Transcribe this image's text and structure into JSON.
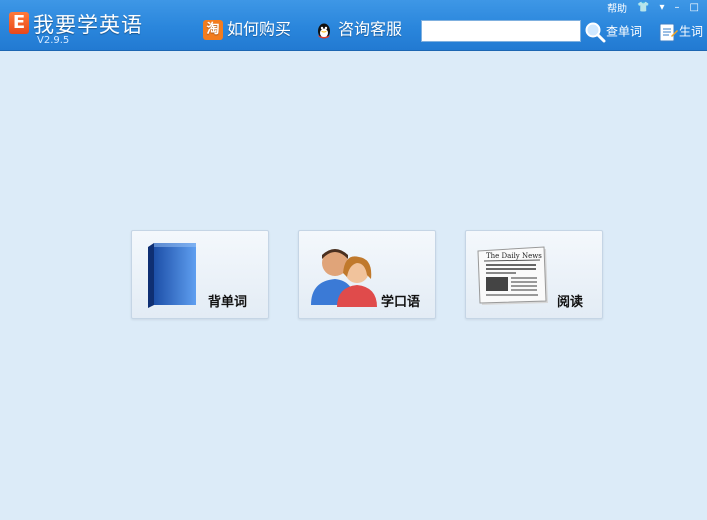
{
  "app": {
    "title": "我要学英语",
    "version": "V2.9.5",
    "logo_letter": "E"
  },
  "window_controls": {
    "help": "帮助",
    "skin": "👕",
    "menu": "▾",
    "minimize": "–",
    "maximize": "□"
  },
  "nav": {
    "buy": {
      "label": "如何购买",
      "icon": "淘"
    },
    "support": {
      "label": "咨询客服"
    }
  },
  "search": {
    "value": "",
    "placeholder": "",
    "button_label": "查单词"
  },
  "vocab_button": {
    "label": "生词"
  },
  "cards": [
    {
      "label": "背单词",
      "icon": "book-icon"
    },
    {
      "label": "学口语",
      "icon": "people-icon"
    },
    {
      "label": "阅读",
      "icon": "newspaper-icon"
    }
  ],
  "newspaper_title": "The Daily News",
  "colors": {
    "titlebar": "#2a86dc",
    "background": "#dcebf8",
    "logo": "#e8481b"
  }
}
